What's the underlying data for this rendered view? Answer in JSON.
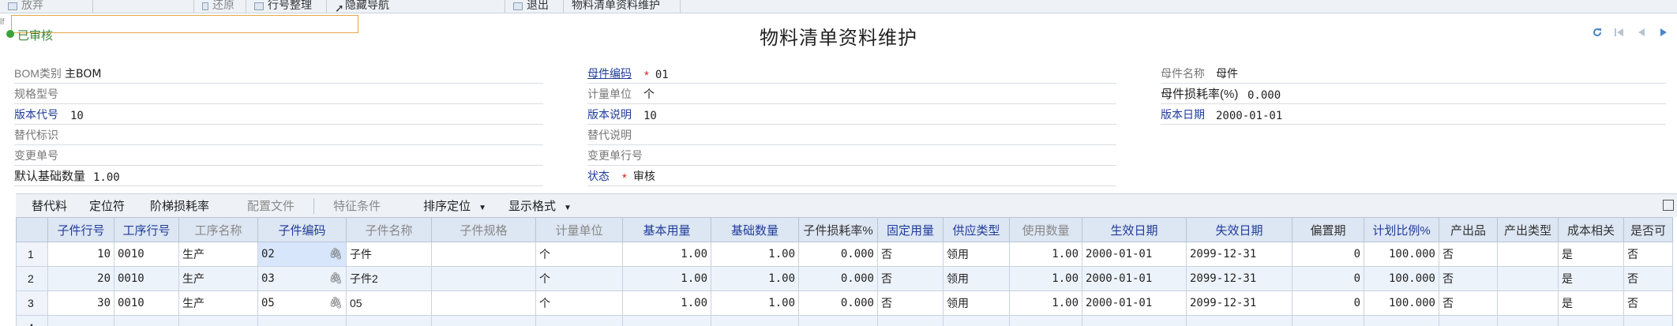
{
  "toolbar": {
    "items": [
      "放弃",
      "还原",
      "行号整理",
      "隐藏导航",
      "退出",
      "物料清单资料维护"
    ]
  },
  "filter": {
    "prefix": "lf",
    "value": ""
  },
  "status_label": "已审核",
  "page_title": "物料清单资料维护",
  "form": {
    "bom_type": {
      "label": "BOM类别",
      "value": "主BOM"
    },
    "spec": {
      "label": "规格型号",
      "value": ""
    },
    "version_code": {
      "label": "版本代号",
      "value": "10"
    },
    "alt_flag": {
      "label": "替代标识",
      "value": ""
    },
    "change_no": {
      "label": "变更单号",
      "value": ""
    },
    "default_qty": {
      "label": "默认基础数量",
      "value": "1.00"
    },
    "parent_code": {
      "label": "母件编码",
      "required": "*",
      "value": "01"
    },
    "unit": {
      "label": "计量单位",
      "value": "个"
    },
    "version_desc": {
      "label": "版本说明",
      "value": "10"
    },
    "alt_desc": {
      "label": "替代说明",
      "value": ""
    },
    "change_line": {
      "label": "变更单行号",
      "value": ""
    },
    "state": {
      "label": "状态",
      "required": "*",
      "value": "审核"
    },
    "parent_name": {
      "label": "母件名称",
      "value": "母件"
    },
    "parent_loss": {
      "label": "母件损耗率(%)",
      "value": "0.000"
    },
    "version_date": {
      "label": "版本日期",
      "value": "2000-01-01"
    }
  },
  "grid_toolbar": {
    "substitute": "替代料",
    "locator": "定位符",
    "ladder_loss": "阶梯损耗率",
    "config_file": "配置文件",
    "feature_cond": "特征条件",
    "sort_locate": "排序定位",
    "display_format": "显示格式"
  },
  "grid": {
    "columns": [
      "",
      "子件行号",
      "工序行号",
      "工序名称",
      "子件编码",
      "子件名称",
      "子件规格",
      "计量单位",
      "基本用量",
      "基础数量",
      "子件损耗率%",
      "固定用量",
      "供应类型",
      "使用数量",
      "生效日期",
      "失效日期",
      "偏置期",
      "计划比例%",
      "产出品",
      "产出类型",
      "成本相关",
      "是否可"
    ],
    "rows": [
      [
        "1",
        "10",
        "0010",
        "生产",
        "02",
        "子件",
        "",
        "个",
        "1.00",
        "1.00",
        "0.000",
        "否",
        "领用",
        "1.00",
        "2000-01-01",
        "2099-12-31",
        "0",
        "100.000",
        "否",
        "",
        "是",
        "否"
      ],
      [
        "2",
        "20",
        "0010",
        "生产",
        "03",
        "子件2",
        "",
        "个",
        "1.00",
        "1.00",
        "0.000",
        "否",
        "领用",
        "1.00",
        "2000-01-01",
        "2099-12-31",
        "0",
        "100.000",
        "否",
        "",
        "是",
        "否"
      ],
      [
        "3",
        "30",
        "0010",
        "生产",
        "05",
        "05",
        "",
        "个",
        "1.00",
        "1.00",
        "0.000",
        "否",
        "领用",
        "1.00",
        "2000-01-01",
        "2099-12-31",
        "0",
        "100.000",
        "否",
        "",
        "是",
        "否"
      ],
      [
        "4",
        "",
        "",
        "",
        "",
        "",
        "",
        "",
        "",
        "",
        "",
        "",
        "",
        "",
        "",
        "",
        "",
        "",
        "",
        "",
        "",
        ""
      ]
    ]
  }
}
